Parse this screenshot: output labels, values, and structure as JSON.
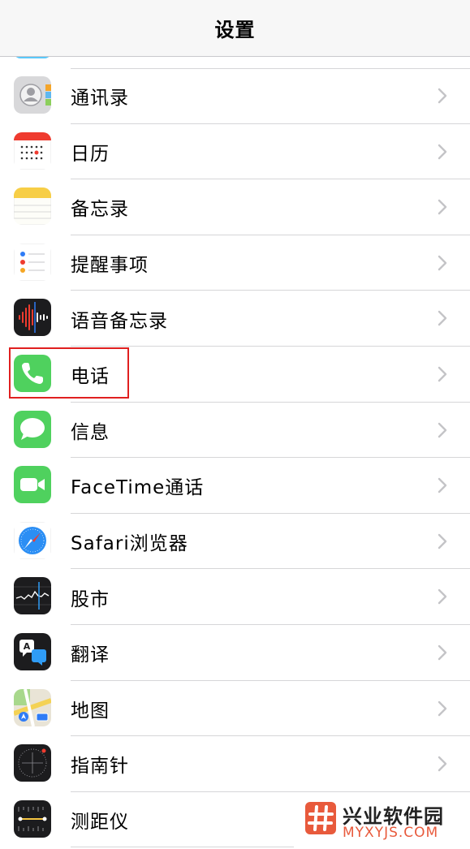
{
  "header": {
    "title": "设置"
  },
  "items": [
    {
      "label": "通讯录",
      "icon": "contacts-icon"
    },
    {
      "label": "日历",
      "icon": "calendar-icon"
    },
    {
      "label": "备忘录",
      "icon": "notes-icon"
    },
    {
      "label": "提醒事项",
      "icon": "reminders-icon"
    },
    {
      "label": "语音备忘录",
      "icon": "voice-memos-icon"
    },
    {
      "label": "电话",
      "icon": "phone-icon"
    },
    {
      "label": "信息",
      "icon": "messages-icon"
    },
    {
      "label": "FaceTime通话",
      "icon": "facetime-icon"
    },
    {
      "label": "Safari浏览器",
      "icon": "safari-icon"
    },
    {
      "label": "股市",
      "icon": "stocks-icon"
    },
    {
      "label": "翻译",
      "icon": "translate-icon"
    },
    {
      "label": "地图",
      "icon": "maps-icon"
    },
    {
      "label": "指南针",
      "icon": "compass-icon"
    },
    {
      "label": "测距仪",
      "icon": "measure-icon"
    }
  ],
  "watermark": {
    "title": "兴业软件园",
    "subtitle": "MYXYJS.COM"
  },
  "colors": {
    "highlight": "#e02020",
    "chevron": "#c4c4c7",
    "separator": "#d6d6d8"
  }
}
